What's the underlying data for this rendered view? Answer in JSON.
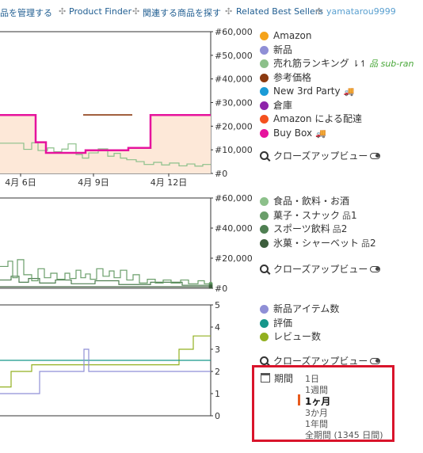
{
  "nav": {
    "items": [
      "品を管理する",
      "Product Finder",
      "関連する商品を探す",
      "Related Best Sellers",
      "yamatarou9999"
    ],
    "separator": "✣"
  },
  "chart1": {
    "legend": [
      {
        "label": "Amazon",
        "color": "#f5a31b"
      },
      {
        "label": "新品",
        "color": "#8f8fd6"
      },
      {
        "label": "売れ筋ランキング",
        "color": "#8cc08a",
        "sort_glyph": "⇂↿",
        "subran": "sub-ran"
      },
      {
        "label": "参考価格",
        "color": "#8b3a10"
      },
      {
        "label": "New 3rd Party",
        "color": "#1a9bd7",
        "truck": "🚚"
      },
      {
        "label": "倉庫",
        "color": "#8e24aa"
      },
      {
        "label": "Amazon による配達",
        "color": "#f4511e"
      },
      {
        "label": "Buy Box",
        "color": "#e6139d",
        "truck": "🚚"
      }
    ],
    "closeup": "クローズアップビュー"
  },
  "chart2": {
    "legend": [
      {
        "label": "食品・飲料・お酒",
        "color": "#8cc08a"
      },
      {
        "label": "菓子・スナック",
        "color": "#6a9e6a",
        "rank": "1"
      },
      {
        "label": "スポーツ飲料",
        "color": "#4f7f52",
        "rank": "2"
      },
      {
        "label": "氷菓・シャーベット",
        "color": "#3c5e3c",
        "rank": "2"
      }
    ],
    "closeup": "クローズアップビュー"
  },
  "chart3": {
    "legend": [
      {
        "label": "新品アイテム数",
        "color": "#8f8fd6"
      },
      {
        "label": "評価",
        "color": "#16968a"
      },
      {
        "label": "レビュー数",
        "color": "#92b020"
      }
    ],
    "closeup": "クローズアップビュー"
  },
  "period": {
    "label": "期間",
    "options": [
      "1日",
      "1週間",
      "1ヶ月",
      "3か月",
      "1年間",
      "全期間 (1345 日間)"
    ],
    "active_index": 2
  },
  "colors": {
    "buybox": "#e6139d",
    "buybox_fill": "#fde8d8",
    "sales_rank": "#8cc08a",
    "list_price": "#8b3a10",
    "new": "#8f8fd6",
    "rating": "#16968a",
    "reviews": "#92b020",
    "period_border": "#d9142b",
    "active_indicator": "#e85b1e"
  },
  "chart_data": [
    {
      "type": "line",
      "y_tick_labels": [
        "#0",
        "#10,000",
        "#20,000",
        "#30,000",
        "#40,000",
        "#50,000",
        "#60,000"
      ],
      "ylim": [
        0,
        60000
      ],
      "x_tick_labels": [
        "4月 6日",
        "4月 9日",
        "4月 12日"
      ],
      "series": [
        {
          "name": "Buy Box",
          "points": [
            [
              0,
              24700
            ],
            [
              45,
              24700
            ],
            [
              45,
              13200
            ],
            [
              58,
              13200
            ],
            [
              58,
              8700
            ],
            [
              108,
              8700
            ],
            [
              108,
              9800
            ],
            [
              162,
              9800
            ],
            [
              162,
              10800
            ],
            [
              190,
              10800
            ],
            [
              190,
              24700
            ],
            [
              266,
              24700
            ]
          ]
        },
        {
          "name": "参考価格",
          "points": [
            [
              105,
              24800
            ],
            [
              167,
              24800
            ]
          ]
        },
        {
          "name": "売れ筋ランキング",
          "points": [
            [
              0,
              12800
            ],
            [
              30,
              12800
            ],
            [
              30,
              10200
            ],
            [
              40,
              10200
            ],
            [
              40,
              13000
            ],
            [
              48,
              13000
            ],
            [
              48,
              9700
            ],
            [
              60,
              9700
            ],
            [
              60,
              10800
            ],
            [
              68,
              10800
            ],
            [
              68,
              9200
            ],
            [
              78,
              9200
            ],
            [
              78,
              10300
            ],
            [
              86,
              10300
            ],
            [
              86,
              12500
            ],
            [
              96,
              12500
            ],
            [
              96,
              8000
            ],
            [
              104,
              8000
            ],
            [
              104,
              6500
            ],
            [
              112,
              6500
            ],
            [
              112,
              8700
            ],
            [
              124,
              8700
            ],
            [
              124,
              10400
            ],
            [
              136,
              10400
            ],
            [
              136,
              7300
            ],
            [
              144,
              7300
            ],
            [
              144,
              8500
            ],
            [
              152,
              8500
            ],
            [
              152,
              6500
            ],
            [
              160,
              6500
            ],
            [
              160,
              5800
            ],
            [
              172,
              5800
            ],
            [
              172,
              5000
            ],
            [
              182,
              5000
            ],
            [
              182,
              3800
            ],
            [
              194,
              3800
            ],
            [
              194,
              4700
            ],
            [
              204,
              4700
            ],
            [
              204,
              3600
            ],
            [
              214,
              3600
            ],
            [
              214,
              4400
            ],
            [
              226,
              4400
            ],
            [
              226,
              3200
            ],
            [
              236,
              3200
            ],
            [
              236,
              4000
            ],
            [
              246,
              4000
            ],
            [
              246,
              3100
            ],
            [
              256,
              3100
            ],
            [
              256,
              3800
            ],
            [
              266,
              3800
            ]
          ]
        }
      ]
    },
    {
      "type": "line",
      "y_tick_labels": [
        "#0",
        "#20,000",
        "#40,000",
        "#60,000"
      ],
      "ylim": [
        0,
        60000
      ],
      "series": [
        {
          "name": "菓子・スナック",
          "points": [
            [
              0,
              14500
            ],
            [
              10,
              14500
            ],
            [
              10,
              18000
            ],
            [
              16,
              18000
            ],
            [
              16,
              7000
            ],
            [
              22,
              7000
            ],
            [
              22,
              19000
            ],
            [
              30,
              19000
            ],
            [
              30,
              9000
            ],
            [
              40,
              9000
            ],
            [
              40,
              5000
            ],
            [
              48,
              5000
            ],
            [
              48,
              13000
            ],
            [
              56,
              13000
            ],
            [
              56,
              7000
            ],
            [
              64,
              7000
            ],
            [
              64,
              10000
            ],
            [
              72,
              10000
            ],
            [
              72,
              6000
            ],
            [
              82,
              6000
            ],
            [
              82,
              10000
            ],
            [
              88,
              10000
            ],
            [
              88,
              6500
            ],
            [
              96,
              6500
            ],
            [
              96,
              12000
            ],
            [
              102,
              12000
            ],
            [
              102,
              7000
            ],
            [
              108,
              7000
            ],
            [
              108,
              9500
            ],
            [
              114,
              9500
            ],
            [
              114,
              6000
            ],
            [
              122,
              6000
            ],
            [
              122,
              13000
            ],
            [
              130,
              13000
            ],
            [
              130,
              8000
            ],
            [
              138,
              8000
            ],
            [
              138,
              11500
            ],
            [
              144,
              11500
            ],
            [
              144,
              7000
            ],
            [
              152,
              7000
            ],
            [
              152,
              12000
            ],
            [
              160,
              12000
            ],
            [
              160,
              5500
            ],
            [
              168,
              5500
            ],
            [
              168,
              9000
            ],
            [
              176,
              9000
            ],
            [
              176,
              3500
            ],
            [
              186,
              3500
            ],
            [
              186,
              6000
            ],
            [
              196,
              6000
            ],
            [
              196,
              3500
            ],
            [
              206,
              3500
            ],
            [
              206,
              5500
            ],
            [
              216,
              5500
            ],
            [
              216,
              3500
            ],
            [
              228,
              3500
            ],
            [
              228,
              5500
            ],
            [
              238,
              5500
            ],
            [
              238,
              3000
            ],
            [
              250,
              3000
            ],
            [
              250,
              5000
            ],
            [
              258,
              5000
            ],
            [
              258,
              3000
            ],
            [
              266,
              3000
            ]
          ]
        },
        {
          "name": "スポーツ飲料",
          "points": [
            [
              0,
              5500
            ],
            [
              14,
              5500
            ],
            [
              14,
              8000
            ],
            [
              24,
              8000
            ],
            [
              24,
              4000
            ],
            [
              36,
              4000
            ],
            [
              36,
              6500
            ],
            [
              50,
              6500
            ],
            [
              50,
              3500
            ],
            [
              70,
              3500
            ],
            [
              70,
              5500
            ],
            [
              90,
              5500
            ],
            [
              90,
              3000
            ],
            [
              120,
              3000
            ],
            [
              120,
              5000
            ],
            [
              150,
              5000
            ],
            [
              150,
              2500
            ],
            [
              190,
              2500
            ],
            [
              190,
              4000
            ],
            [
              230,
              4000
            ],
            [
              230,
              2000
            ],
            [
              266,
              2000
            ]
          ]
        },
        {
          "name": "氷菓・シャーベット",
          "points": [
            [
              0,
              1000
            ],
            [
              266,
              1000
            ]
          ]
        }
      ]
    },
    {
      "type": "line",
      "y_tick_labels": [
        "0",
        "1",
        "2",
        "3",
        "4",
        "5"
      ],
      "ylim": [
        0,
        5
      ],
      "series": [
        {
          "name": "新品アイテム数",
          "points": [
            [
              0,
              1
            ],
            [
              50,
              1
            ],
            [
              50,
              2
            ],
            [
              106,
              2
            ],
            [
              106,
              3
            ],
            [
              112,
              3
            ],
            [
              112,
              2
            ],
            [
              266,
              2
            ]
          ]
        },
        {
          "name": "評価",
          "points": [
            [
              0,
              2.5
            ],
            [
              266,
              2.5
            ]
          ]
        },
        {
          "name": "レビュー数",
          "points": [
            [
              0,
              1.3
            ],
            [
              14,
              1.3
            ],
            [
              14,
              2
            ],
            [
              40,
              2
            ],
            [
              40,
              2.3
            ],
            [
              226,
              2.3
            ],
            [
              226,
              3
            ],
            [
              244,
              3
            ],
            [
              244,
              3.6
            ],
            [
              266,
              3.6
            ]
          ]
        }
      ]
    }
  ]
}
